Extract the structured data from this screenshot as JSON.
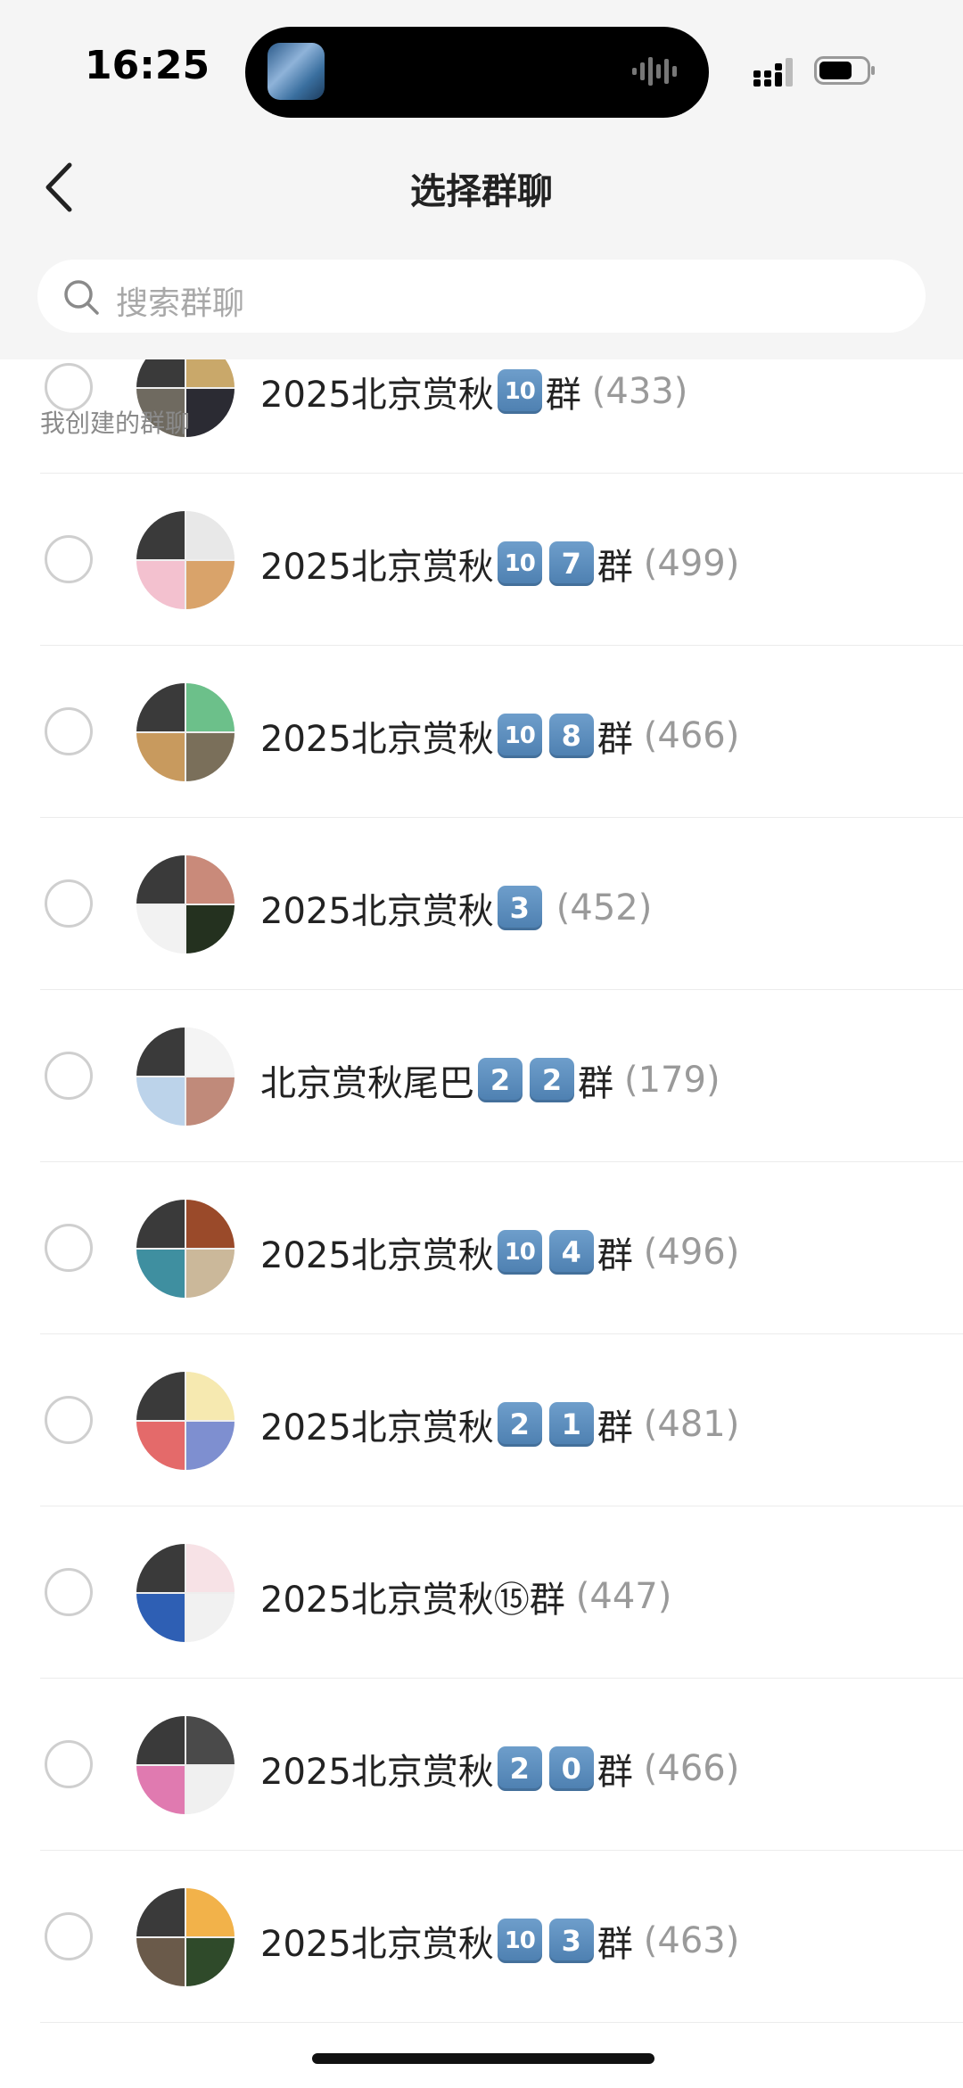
{
  "status_bar": {
    "time": "16:25"
  },
  "nav": {
    "title": "选择群聊"
  },
  "search": {
    "placeholder": "搜索群聊"
  },
  "section": {
    "label": "我创建的群聊"
  },
  "groups": [
    {
      "prefix": "2025北京赏秋",
      "badges": [
        "10"
      ],
      "suffix": "群",
      "count": "(433)",
      "avatar": [
        "#3a3a3a",
        "#c9a86a",
        "#6f6a60",
        "#2b2b33"
      ]
    },
    {
      "prefix": "2025北京赏秋",
      "badges": [
        "10",
        "7"
      ],
      "suffix": "群",
      "count": "(499)",
      "avatar": [
        "#3a3a3a",
        "#e8e8e8",
        "#f3c1cf",
        "#d9a36a"
      ]
    },
    {
      "prefix": "2025北京赏秋",
      "badges": [
        "10",
        "8"
      ],
      "suffix": "群",
      "count": "(466)",
      "avatar": [
        "#3a3a3a",
        "#6cc08a",
        "#c89a5e",
        "#7a6f5a"
      ]
    },
    {
      "prefix": "2025北京赏秋",
      "badges": [
        "3"
      ],
      "suffix": "",
      "count": "(452)",
      "avatar": [
        "#3a3a3a",
        "#c98a7a",
        "#f2f2f2",
        "#24311f"
      ]
    },
    {
      "prefix": "北京赏秋尾巴",
      "badges": [
        "2",
        "2"
      ],
      "suffix": "群",
      "count": "(179)",
      "avatar": [
        "#3a3a3a",
        "#f4f4f4",
        "#bcd3ea",
        "#c08a7a"
      ]
    },
    {
      "prefix": "2025北京赏秋",
      "badges": [
        "10",
        "4"
      ],
      "suffix": "群",
      "count": "(496)",
      "avatar": [
        "#3a3a3a",
        "#9a4a2a",
        "#3f8fa0",
        "#cbb89a"
      ]
    },
    {
      "prefix": "2025北京赏秋",
      "badges": [
        "2",
        "1"
      ],
      "suffix": "群",
      "count": "(481)",
      "avatar": [
        "#3a3a3a",
        "#f6e9b0",
        "#e46a6a",
        "#7e8fd0"
      ]
    },
    {
      "prefix": "2025北京赏秋⑮群",
      "badges": [],
      "suffix": "",
      "count": "(447)",
      "avatar": [
        "#3a3a3a",
        "#f7e2e6",
        "#2e5fb4",
        "#f1f1f1"
      ]
    },
    {
      "prefix": "2025北京赏秋",
      "badges": [
        "2",
        "0"
      ],
      "suffix": "群",
      "count": "(466)",
      "avatar": [
        "#3a3a3a",
        "#4a4a4a",
        "#e07ab0",
        "#f0f0f0"
      ]
    },
    {
      "prefix": "2025北京赏秋",
      "badges": [
        "10",
        "3"
      ],
      "suffix": "群",
      "count": "(463)",
      "avatar": [
        "#3a3a3a",
        "#f2b24a",
        "#6a5a4a",
        "#2f4a2a"
      ]
    }
  ]
}
